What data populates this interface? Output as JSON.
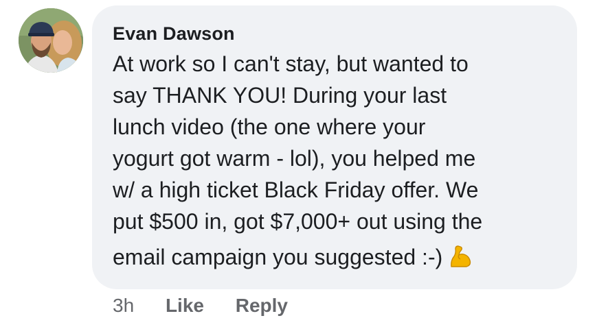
{
  "comment": {
    "author": "Evan Dawson",
    "lines": [
      "At work so I can't stay, but wanted to",
      "say THANK YOU! During your last",
      "lunch video (the one where your",
      "yogurt got warm - lol), you helped me",
      "w/ a high ticket Black Friday offer. We",
      "put $500 in, got $7,000+ out using the",
      "email campaign you suggested :-)"
    ],
    "emoji": "flexed-biceps-icon"
  },
  "actions": {
    "time": "3h",
    "like_label": "Like",
    "reply_label": "Reply"
  },
  "colors": {
    "bubble": "#f0f2f5",
    "text": "#1c1e21",
    "meta": "#65676b"
  }
}
